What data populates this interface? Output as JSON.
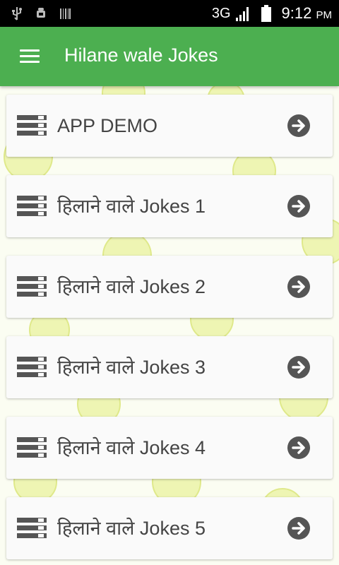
{
  "status_bar": {
    "network": "3G",
    "time": "9:12",
    "ampm": "PM",
    "icons": [
      "usb-icon",
      "android-debug-icon",
      "barcode-icon",
      "signal-icon",
      "battery-icon"
    ]
  },
  "app_bar": {
    "title": "Hilane wale Jokes",
    "menu_icon": "hamburger-menu-icon",
    "color": "#4caf50"
  },
  "list": {
    "item_icon": "list-icon",
    "action_icon": "arrow-circle-right-icon",
    "items": [
      {
        "label": "APP DEMO"
      },
      {
        "label": "हिलाने वाले Jokes 1"
      },
      {
        "label": "हिलाने वाले Jokes 2"
      },
      {
        "label": "हिलाने वाले Jokes 3"
      },
      {
        "label": "हिलाने वाले Jokes 4"
      },
      {
        "label": "हिलाने वाले Jokes 5"
      }
    ]
  }
}
